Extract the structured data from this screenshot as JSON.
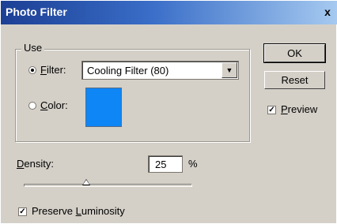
{
  "window": {
    "title": "Photo Filter",
    "close_glyph": "x"
  },
  "use_group": {
    "label": "Use",
    "filter_radio": {
      "label_underline": "F",
      "label_rest": "ilter:",
      "checked": true
    },
    "filter_select": {
      "value": "Cooling Filter (80)",
      "arrow_icon": "dropdown-arrow-icon"
    },
    "color_radio": {
      "label_underline": "C",
      "label_rest": "olor:",
      "checked": false
    },
    "color_swatch": {
      "color": "#0e86f6"
    }
  },
  "buttons": {
    "ok": "OK",
    "reset": "Reset"
  },
  "preview": {
    "label_underline": "P",
    "label_rest": "review",
    "checked": true,
    "check_glyph": "✓"
  },
  "density": {
    "label_underline": "D",
    "label_rest": "ensity:",
    "value": "25",
    "unit": "%",
    "slider_fraction": 0.25
  },
  "preserve_luminosity": {
    "label_pre": "Preserve ",
    "label_underline": "L",
    "label_rest": "uminosity",
    "checked": true,
    "check_glyph": "✓"
  }
}
